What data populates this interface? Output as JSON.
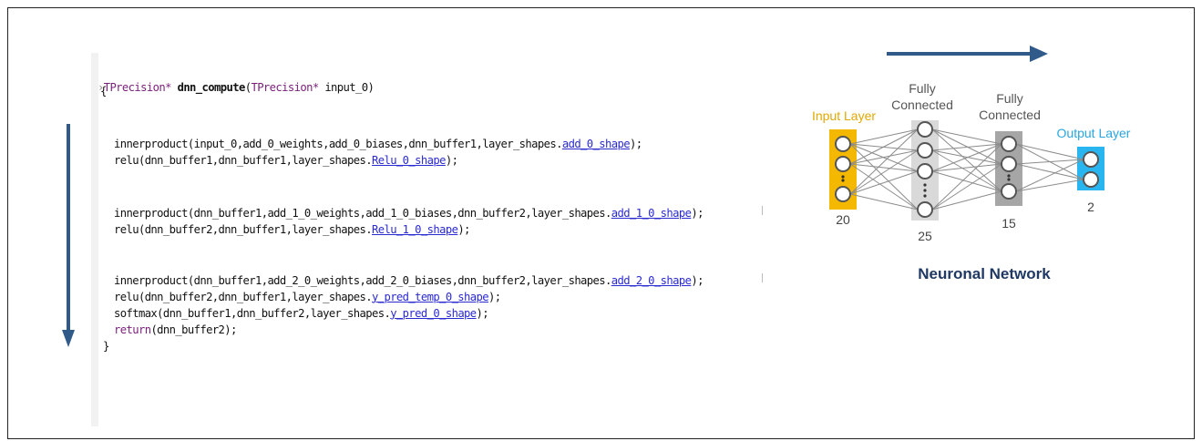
{
  "code": {
    "signature": {
      "ret_type": "TPrecision*",
      "fn_name": "dnn_compute",
      "open": "(",
      "param_type": "TPrecision*",
      "param_name": " input_0)"
    },
    "open_brace": "{",
    "close_brace": "}",
    "lines": {
      "l1_pre": "innerproduct(input_0,add_0_weights,add_0_biases,dnn_buffer1,layer_shapes.",
      "l1_field": "add_0_shape",
      "l1_post": ");",
      "l2_pre": "relu(dnn_buffer1,dnn_buffer1,layer_shapes.",
      "l2_field": "Relu_0_shape",
      "l2_post": ");",
      "l3_pre": "innerproduct(dnn_buffer1,add_1_0_weights,add_1_0_biases,dnn_buffer2,layer_shapes.",
      "l3_field": "add_1_0_shape",
      "l3_post": ");",
      "l4_pre": "relu(dnn_buffer2,dnn_buffer1,layer_shapes.",
      "l4_field": "Relu_1_0_shape",
      "l4_post": ");",
      "l5_pre": "innerproduct(dnn_buffer1,add_2_0_weights,add_2_0_biases,dnn_buffer2,layer_shapes.",
      "l5_field": "add_2_0_shape",
      "l5_post": ");",
      "l6_pre": "relu(dnn_buffer2,dnn_buffer1,layer_shapes.",
      "l6_field": "y_pred_temp_0_shape",
      "l6_post": ");",
      "l7_pre": "softmax(dnn_buffer1,dnn_buffer2,layer_shapes.",
      "l7_field": "y_pred_0_shape",
      "l7_post": ");",
      "l8_kw": "return",
      "l8_post": "(dnn_buffer2);"
    }
  },
  "diagram": {
    "input_label": "Input Layer",
    "fc1_label_line1": "Fully",
    "fc1_label_line2": "Connected",
    "fc2_label_line1": "Fully",
    "fc2_label_line2": "Connected",
    "output_label": "Output Layer",
    "input_count": "20",
    "fc1_count": "25",
    "fc2_count": "15",
    "output_count": "2",
    "caption": "Neuronal Network",
    "colors": {
      "input": "#f5b800",
      "hidden_box": "#d9d9d9",
      "hidden_box_dark": "#a6a6a6",
      "output": "#29b6f0",
      "arrow": "#2f5a8a",
      "caption": "#1f3864"
    }
  }
}
